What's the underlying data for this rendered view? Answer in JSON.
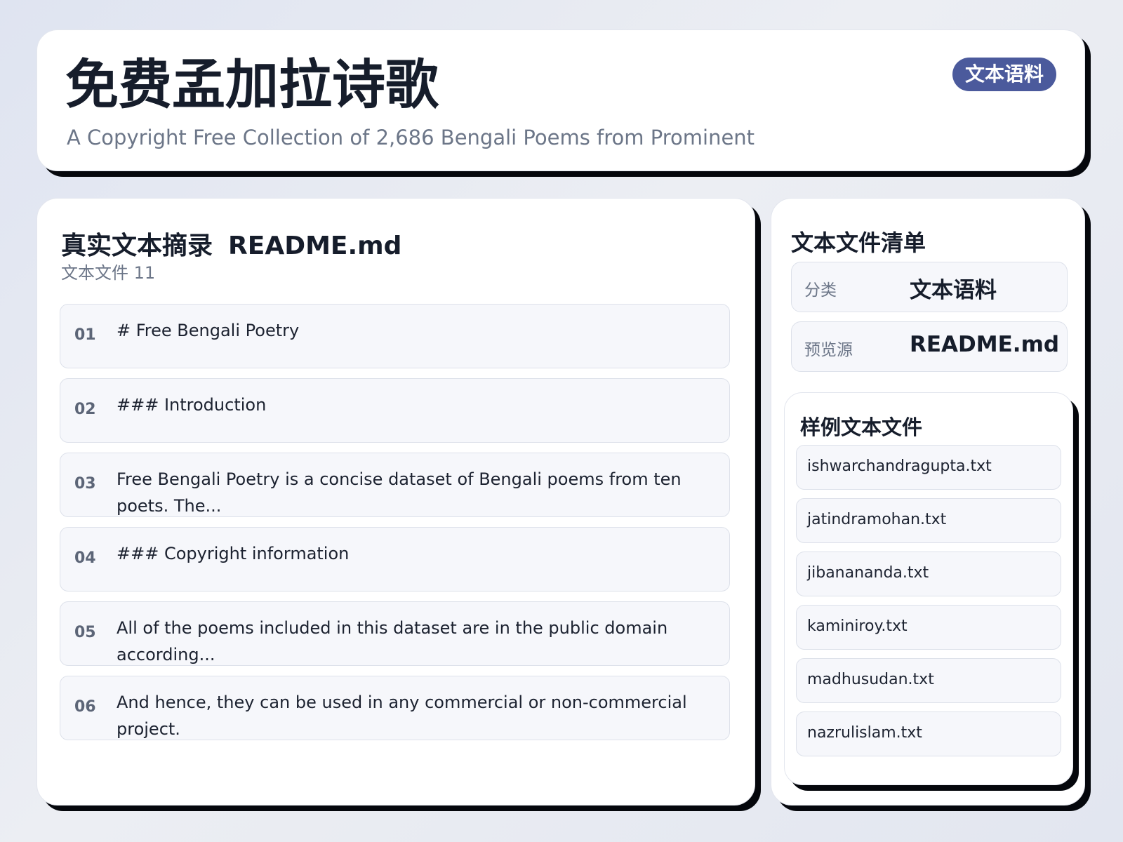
{
  "header": {
    "title": "免费孟加拉诗歌",
    "subtitle": "A Copyright Free Collection of 2,686 Bengali Poems from Prominent",
    "badge": "文本语料"
  },
  "excerpt": {
    "title": "真实文本摘录",
    "file": "README.md",
    "subtitle": "文本文件 11",
    "lines": [
      {
        "num": "01",
        "text": "# Free Bengali Poetry"
      },
      {
        "num": "02",
        "text": "### Introduction"
      },
      {
        "num": "03",
        "text": "Free Bengali Poetry is a concise dataset of Bengali poems from ten poets. The..."
      },
      {
        "num": "04",
        "text": "### Copyright information"
      },
      {
        "num": "05",
        "text": "All of the poems included in this dataset are in the public domain according..."
      },
      {
        "num": "06",
        "text": "And hence, they can be used in any commercial or non-commercial project."
      }
    ]
  },
  "manifest": {
    "title": "文本文件清单",
    "category_label": "分类",
    "category_value": "文本语料",
    "source_label": "预览源",
    "source_value": "README.md"
  },
  "samples": {
    "title": "样例文本文件",
    "files": [
      "ishwarchandragupta.txt",
      "jatindramohan.txt",
      "jibanananda.txt",
      "kaminiroy.txt",
      "madhusudan.txt",
      "nazrulislam.txt"
    ]
  },
  "colors": {
    "badge_bg": "#4b5a9c",
    "card_shadow": "#05070c",
    "row_bg": "#f6f7fb"
  }
}
